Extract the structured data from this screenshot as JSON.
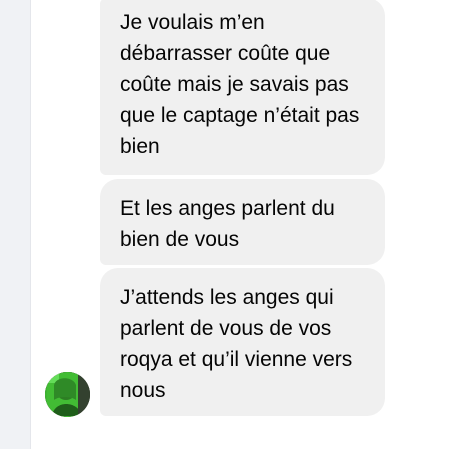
{
  "messages": [
    {
      "text": "Je voulais m’en débarrasser coûte que coûte mais je savais pas que le captage n’était pas bien"
    },
    {
      "text": "Et les anges parlent du bien de vous"
    },
    {
      "text": "J’attends les anges qui parlent de vous de vos roqya et qu’il vienne vers nous"
    }
  ],
  "colors": {
    "bubble_background": "#f0f0f0",
    "text": "#050505",
    "sidebar_background": "#f0f2f5",
    "avatar_overlay": "#55e23a"
  },
  "avatar": {
    "icon": "user-avatar-icon"
  }
}
